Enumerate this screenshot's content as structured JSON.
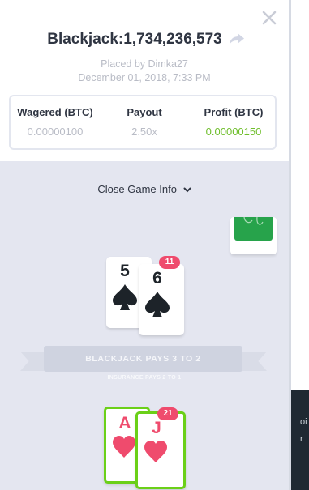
{
  "bet": {
    "title": "Blackjack:1,734,236,573",
    "placed_by": "Placed by Dimka27",
    "date": "December 01, 2018, 7:33 PM"
  },
  "stats": [
    {
      "label": "Wagered (BTC)",
      "value": "0.00000100"
    },
    {
      "label": "Payout",
      "value": "2.50x"
    },
    {
      "label": "Profit (BTC)",
      "value": "0.00000150"
    }
  ],
  "game_info": {
    "toggle_label": "Close Game Info",
    "banner": "BLACKJACK PAYS 3 TO 2",
    "insurance": "INSURANCE PAYS 2 TO 1"
  },
  "dealer": {
    "cards": [
      {
        "rank": "5",
        "suit": "spade"
      },
      {
        "rank": "6",
        "suit": "spade"
      }
    ],
    "total": "11"
  },
  "player": {
    "cards": [
      {
        "rank": "A",
        "suit": "heart"
      },
      {
        "rank": "J",
        "suit": "heart"
      }
    ],
    "total": "21"
  },
  "backdrop": {
    "peek_1": "oi",
    "peek_2": "r"
  },
  "colors": {
    "profit_green": "#6fbe2c",
    "winning_border": "#6bd018",
    "badge_red": "#ef4b6d",
    "deck_green": "#27a34b"
  },
  "icons": [
    "close-icon",
    "share-icon",
    "chevron-down-icon",
    "spade-icon",
    "heart-icon"
  ]
}
